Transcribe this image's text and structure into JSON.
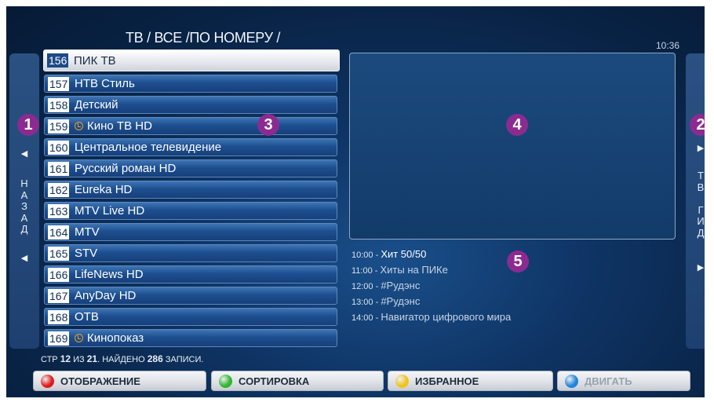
{
  "header": {
    "breadcrumb": "ТВ / ВСЕ /ПО НОМЕРУ /",
    "clock": "10:36"
  },
  "left_panel": {
    "label_letters": [
      "Н",
      "А",
      "З",
      "А",
      "Д"
    ]
  },
  "right_panel": {
    "label_letters": [
      "Т",
      "В",
      "",
      "Г",
      "И",
      "Д"
    ]
  },
  "badges": [
    "1",
    "2",
    "3",
    "4",
    "5"
  ],
  "channels": [
    {
      "number": "156",
      "name": "ПИК ТВ",
      "selected": true,
      "recording": false
    },
    {
      "number": "157",
      "name": "НТВ Стиль",
      "selected": false,
      "recording": false
    },
    {
      "number": "158",
      "name": "Детский",
      "selected": false,
      "recording": false
    },
    {
      "number": "159",
      "name": "Кино ТВ HD",
      "selected": false,
      "recording": true
    },
    {
      "number": "160",
      "name": "Центральное телевидение",
      "selected": false,
      "recording": false
    },
    {
      "number": "161",
      "name": "Русский роман HD",
      "selected": false,
      "recording": false
    },
    {
      "number": "162",
      "name": "Eureka HD",
      "selected": false,
      "recording": false
    },
    {
      "number": "163",
      "name": "MTV Live HD",
      "selected": false,
      "recording": false
    },
    {
      "number": "164",
      "name": "MTV",
      "selected": false,
      "recording": false
    },
    {
      "number": "165",
      "name": "STV",
      "selected": false,
      "recording": false
    },
    {
      "number": "166",
      "name": "LifeNews HD",
      "selected": false,
      "recording": false
    },
    {
      "number": "167",
      "name": "AnyDay HD",
      "selected": false,
      "recording": false
    },
    {
      "number": "168",
      "name": "ОТВ",
      "selected": false,
      "recording": false
    },
    {
      "number": "169",
      "name": "Кинопоказ",
      "selected": false,
      "recording": true
    }
  ],
  "epg": [
    {
      "time": "10:00",
      "sep": " - ",
      "title": "Хит 50/50",
      "current": true
    },
    {
      "time": "11:00",
      "sep": " - ",
      "title": "Хиты на ПИКе",
      "current": false
    },
    {
      "time": "12:00",
      "sep": " - ",
      "title": "#Рудэнс",
      "current": false
    },
    {
      "time": "13:00",
      "sep": " - ",
      "title": "#Рудэнс",
      "current": false
    },
    {
      "time": "14:00",
      "sep": " - ",
      "title": "Навигатор цифрового мира",
      "current": false
    }
  ],
  "footer": {
    "prefix": "СТР ",
    "page": "12",
    "of": " ИЗ ",
    "total": "21",
    "found": ". НАЙДЕНО ",
    "count": "286",
    "suffix": " ЗАПИСИ."
  },
  "buttons": [
    {
      "label": "ОТОБРАЖЕНИЕ",
      "color": "#e01a1a",
      "disabled": false
    },
    {
      "label": "СОРТИРОВКА",
      "color": "#2fb52f",
      "disabled": false
    },
    {
      "label": "ИЗБРАННОЕ",
      "color": "#f0c419",
      "disabled": false
    },
    {
      "label": "ДВИГАТЬ",
      "color": "#1f86d8",
      "disabled": true
    }
  ]
}
